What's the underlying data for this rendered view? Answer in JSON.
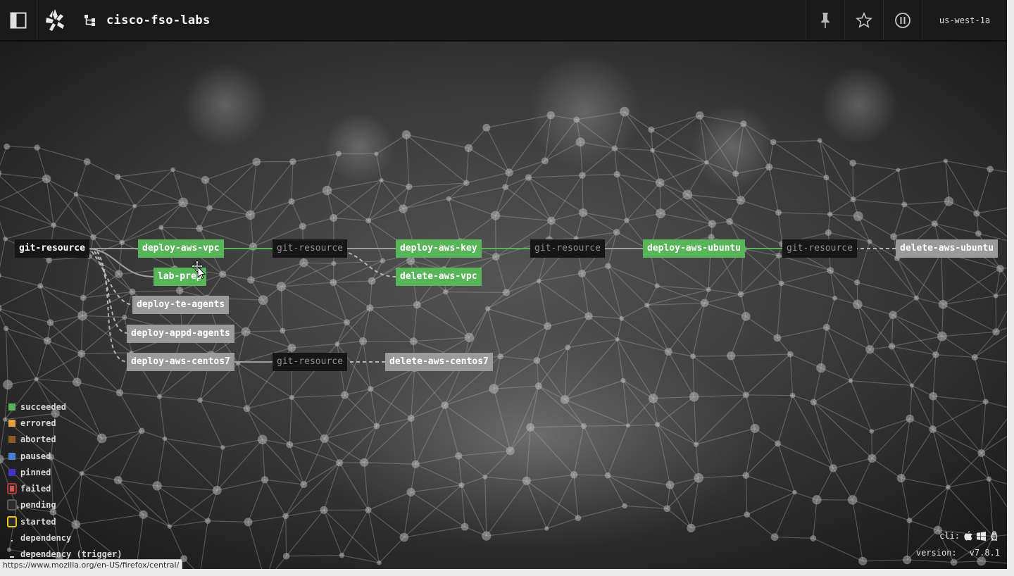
{
  "topbar": {
    "pipeline_name": "cisco-fso-labs",
    "team": "us-west-1a",
    "icons": [
      "sidebar-toggle-icon",
      "concourse-logo-icon",
      "pipeline-icon",
      "pin-icon",
      "star-icon",
      "pause-icon"
    ]
  },
  "graph": {
    "nodes": {
      "git_resource_main": "git-resource",
      "deploy_aws_vpc": "deploy-aws-vpc",
      "git_resource_2": "git-resource",
      "deploy_aws_key": "deploy-aws-key",
      "git_resource_3": "git-resource",
      "deploy_aws_ubuntu": "deploy-aws-ubuntu",
      "git_resource_4": "git-resource",
      "delete_aws_ubuntu": "delete-aws-ubuntu",
      "lab_prep": "lab-prep",
      "delete_aws_vpc": "delete-aws-vpc",
      "deploy_te_agents": "deploy-te-agents",
      "deploy_appd_agents": "deploy-appd-agents",
      "deploy_aws_centos7": "deploy-aws-centos7",
      "git_resource_5": "git-resource",
      "delete_aws_centos7": "delete-aws-centos7"
    },
    "statuses": {
      "deploy_aws_vpc": "succeeded",
      "deploy_aws_key": "succeeded",
      "deploy_aws_ubuntu": "succeeded",
      "lab_prep": "succeeded",
      "delete_aws_vpc": "succeeded",
      "delete_aws_ubuntu": "pending",
      "deploy_te_agents": "pending",
      "deploy_appd_agents": "pending",
      "deploy_aws_centos7": "pending",
      "delete_aws_centos7": "pending"
    }
  },
  "legend": {
    "items": [
      {
        "label": "succeeded",
        "color": "#59b559",
        "style": "fill"
      },
      {
        "label": "errored",
        "color": "#e6a23c",
        "style": "fill"
      },
      {
        "label": "aborted",
        "color": "#8b5a2b",
        "style": "fill"
      },
      {
        "label": "paused",
        "color": "#4a7fd8",
        "style": "fill"
      },
      {
        "label": "pinned",
        "color": "#3f35c8",
        "style": "fill"
      },
      {
        "label": "failed",
        "color": "#d9534f",
        "style": "outline-red"
      },
      {
        "label": "pending",
        "color": "#3a3a3a",
        "style": "outline-gray"
      },
      {
        "label": "started",
        "color": "#f0c419",
        "style": "outline-yellow"
      },
      {
        "label": "dependency",
        "color": "#d8d8d8",
        "style": "dot"
      },
      {
        "label": "dependency (trigger)",
        "color": "#d8d8d8",
        "style": "dash"
      }
    ]
  },
  "footer": {
    "cli_label": "cli:",
    "cli_icons": [
      "apple-icon",
      "windows-icon",
      "linux-icon"
    ],
    "version_label": "version:",
    "version_value": "v7.8.1"
  },
  "status_url": "https://www.mozilla.org/en-US/firefox/central/"
}
